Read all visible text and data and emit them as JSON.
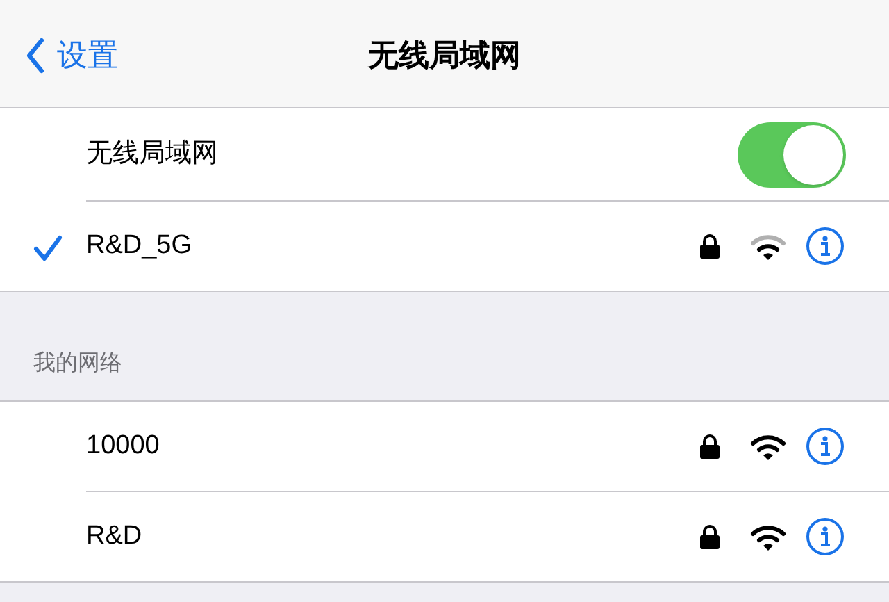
{
  "nav": {
    "back_label": "设置",
    "title": "无线局域网"
  },
  "wifi_toggle": {
    "label": "无线局域网",
    "on": true
  },
  "current_network": {
    "name": "R&D_5G",
    "connected": true,
    "locked": true,
    "weak_signal": true
  },
  "section_header": "我的网络",
  "networks": [
    {
      "name": "10000",
      "locked": true,
      "weak_signal": false
    },
    {
      "name": "R&D",
      "locked": true,
      "weak_signal": false
    }
  ]
}
